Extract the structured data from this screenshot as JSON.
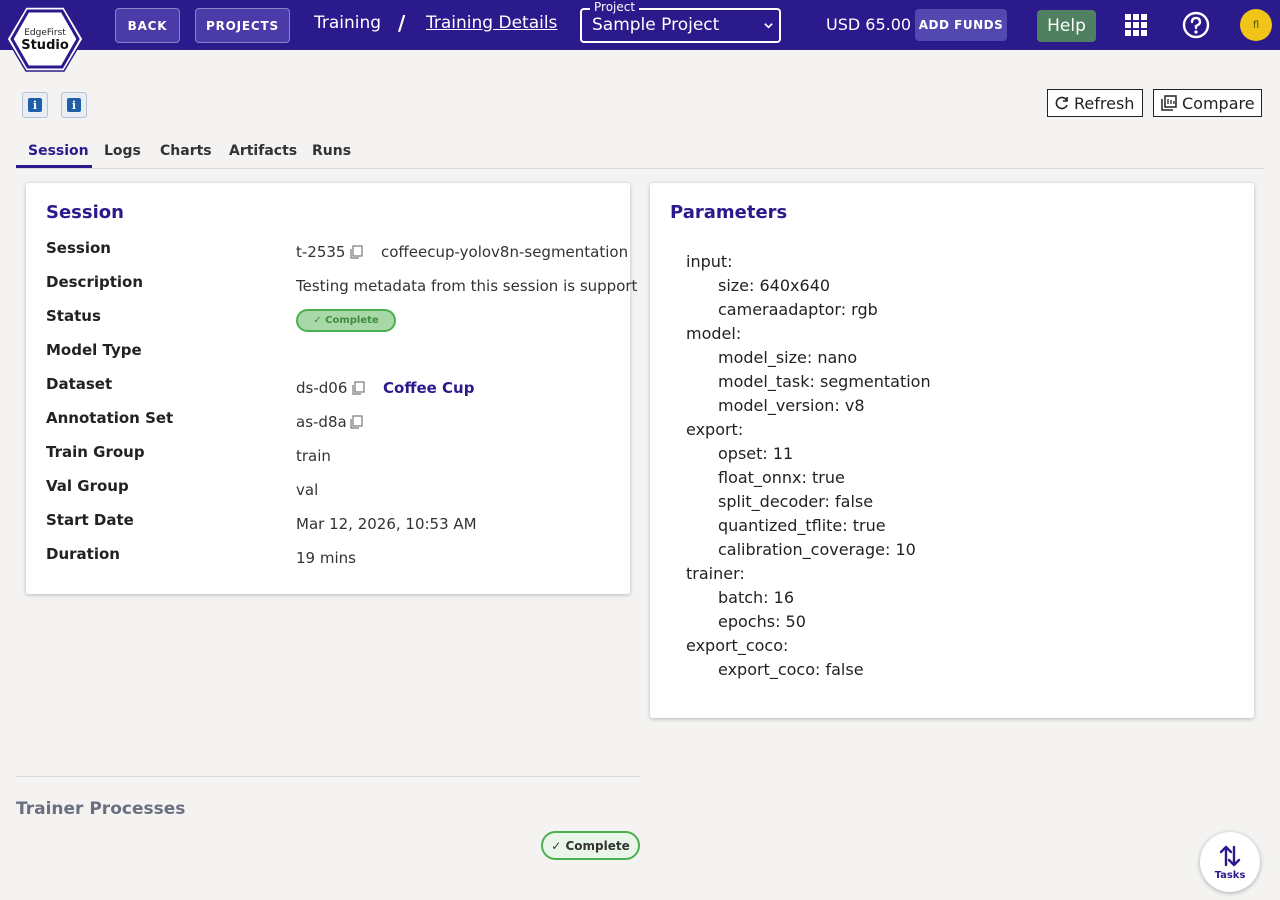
{
  "logo": {
    "line1": "EdgeFirst",
    "line2": "Studio"
  },
  "header": {
    "back_label": "BACK",
    "projects_label": "PROJECTS",
    "breadcrumb": [
      "Training",
      "Training Details"
    ],
    "breadcrumb_sep": "/",
    "project_select": {
      "legend": "Project",
      "value": "Sample Project"
    },
    "balance": "USD 65.00",
    "add_funds_label": "ADD FUNDS",
    "help_label": "Help",
    "avatar_initials": "fl"
  },
  "toolbar": {
    "info_glyph": "i",
    "refresh_label": "Refresh",
    "compare_label": "Compare"
  },
  "tabs": [
    "Session",
    "Logs",
    "Charts",
    "Artifacts",
    "Runs"
  ],
  "session_card": {
    "title": "Session",
    "rows": [
      {
        "label": "Session",
        "value": "t-2535",
        "extra": "coffeecup-yolov8n-segmentation"
      },
      {
        "label": "Description",
        "value": "Testing metadata from this session is support"
      },
      {
        "label": "Status",
        "value": "✓ Complete"
      },
      {
        "label": "Model Type",
        "value": ""
      },
      {
        "label": "Dataset",
        "value": "ds-d06",
        "extra": "Coffee Cup"
      },
      {
        "label": "Annotation Set",
        "value": "as-d8a"
      },
      {
        "label": "Train Group",
        "value": "train"
      },
      {
        "label": "Val Group",
        "value": "val"
      },
      {
        "label": "Start Date",
        "value": "Mar 12, 2026, 10:53 AM"
      },
      {
        "label": "Duration",
        "value": "19 mins"
      }
    ]
  },
  "parameters_card": {
    "title": "Parameters",
    "lines": [
      "input:",
      "size: 640x640",
      "cameraadaptor: rgb",
      "model:",
      "model_size: nano",
      "model_task: segmentation",
      "model_version: v8",
      "export:",
      "opset: 11",
      "float_onnx: true",
      "split_decoder: false",
      "quantized_tflite: true",
      "calibration_coverage: 10",
      "trainer:",
      "batch: 16",
      "epochs: 50",
      "export_coco:",
      "export_coco: false"
    ]
  },
  "trainer_processes": {
    "title": "Trainer Processes",
    "status": "✓ Complete"
  },
  "tasks_fab": {
    "label": "Tasks"
  },
  "colors": {
    "brand": "#2a1a8c",
    "success": "#4caf50",
    "help": "#4f8060",
    "avatar": "#f0c419"
  }
}
